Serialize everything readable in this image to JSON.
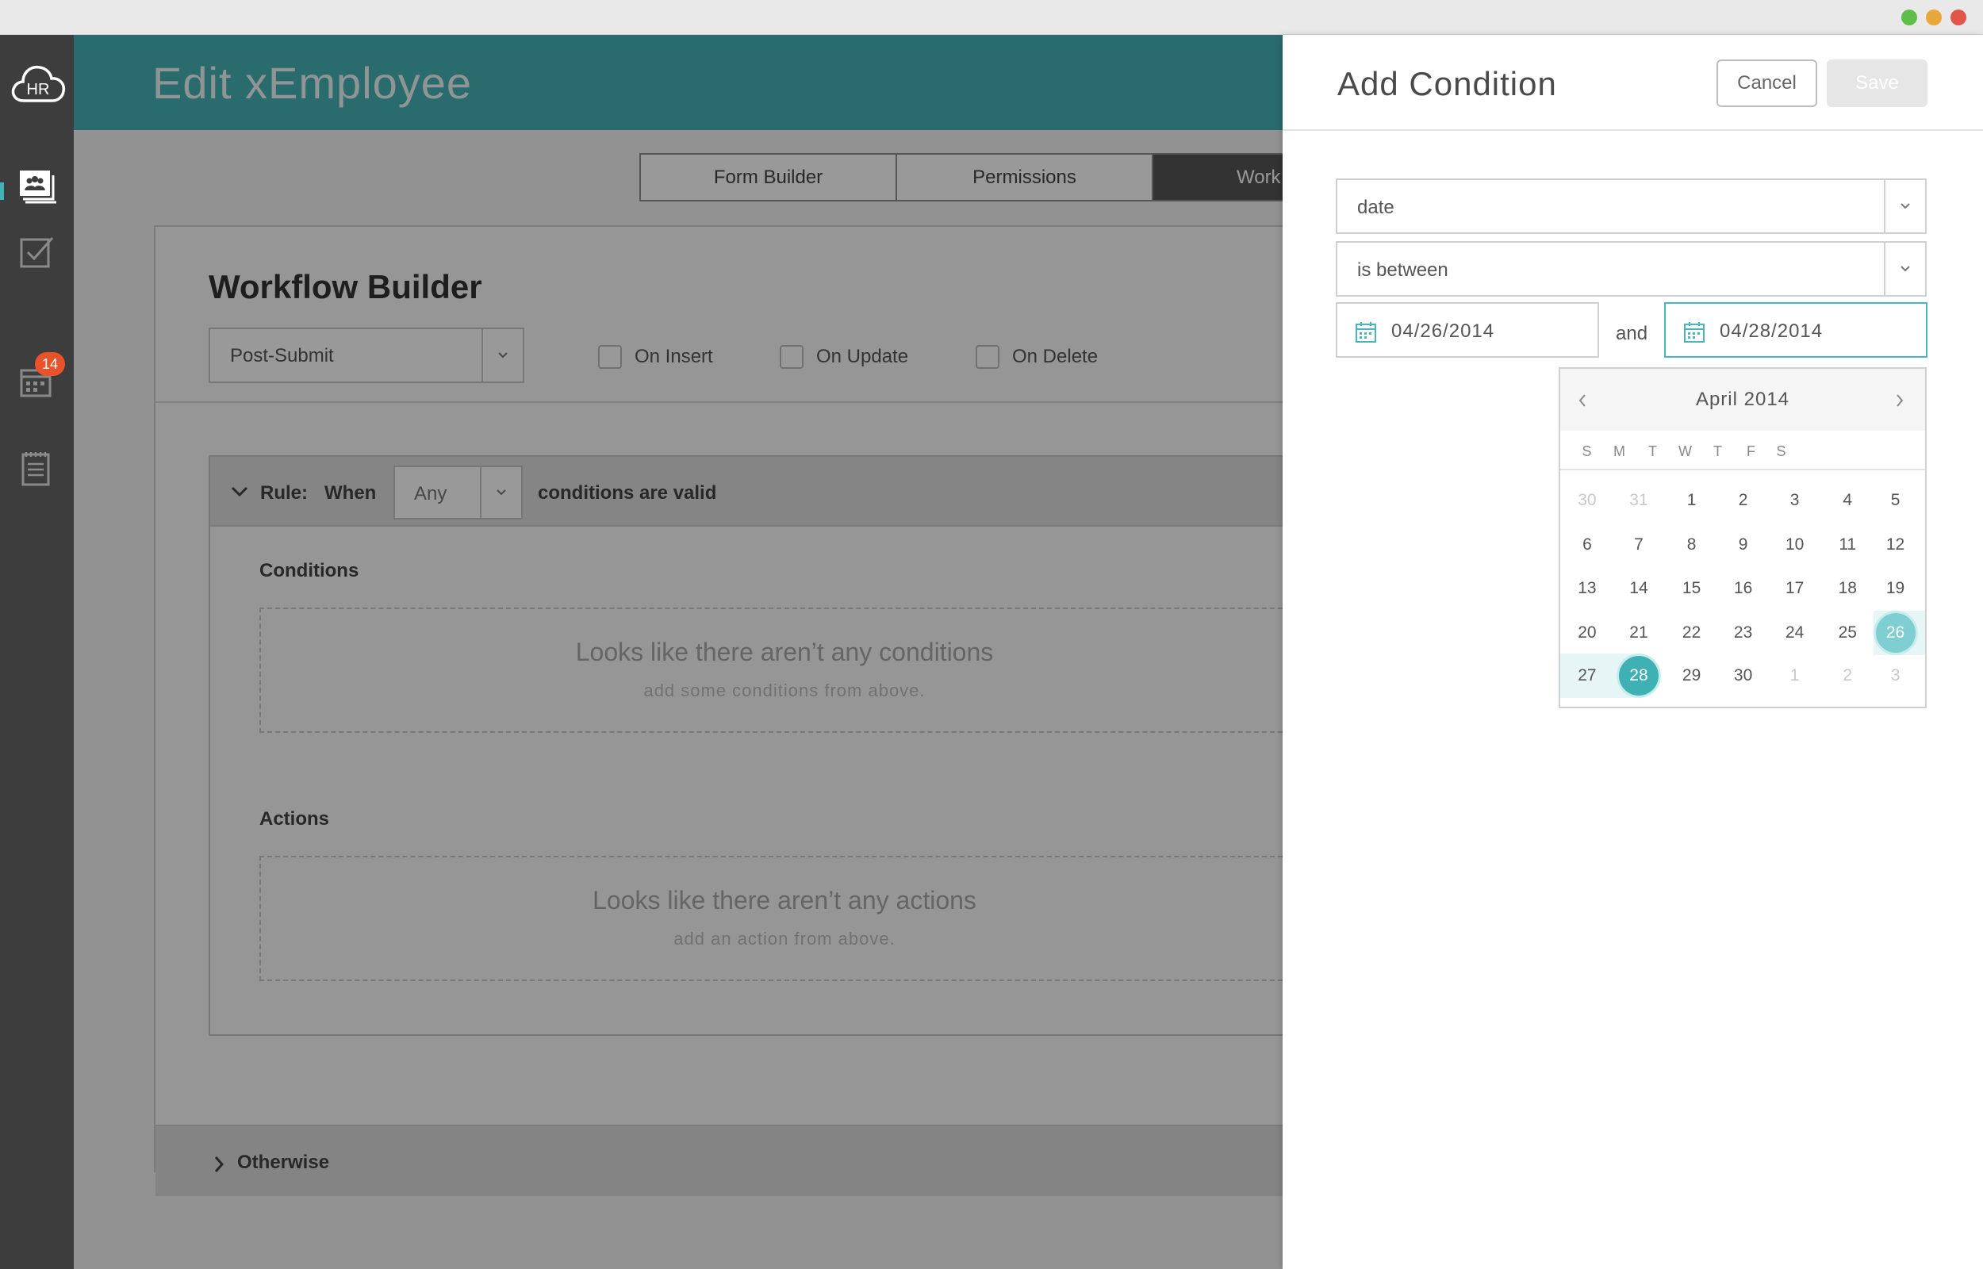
{
  "main": {
    "title": "Edit xEmployee",
    "tabs": [
      {
        "label": "Form Builder"
      },
      {
        "label": "Permissions"
      },
      {
        "label": "Work"
      }
    ]
  },
  "sidebar": {
    "logo_text": "HR",
    "badge_count": "14",
    "items": [
      {
        "icon": "people-icon",
        "active": true
      },
      {
        "icon": "check-icon",
        "active": false
      },
      {
        "icon": "calendar-icon",
        "active": false
      },
      {
        "icon": "notepad-icon",
        "active": false
      }
    ]
  },
  "workflow": {
    "title": "Workflow Builder",
    "trigger_select": "Post-Submit",
    "checkboxes": [
      {
        "label": "On Insert",
        "checked": false
      },
      {
        "label": "On Update",
        "checked": false
      },
      {
        "label": "On Delete",
        "checked": false
      }
    ],
    "rule": {
      "label": "Rule:",
      "when": "When",
      "match": "Any",
      "suffix": "conditions are valid",
      "conditions_label": "Conditions",
      "conditions_empty_title": "Looks like there aren’t any conditions",
      "conditions_empty_sub": "add some conditions from above.",
      "actions_label": "Actions",
      "actions_empty_title": "Looks like there aren’t any actions",
      "actions_empty_sub": "add an action from above."
    },
    "otherwise_label": "Otherwise"
  },
  "panel": {
    "title": "Add Condition",
    "cancel_label": "Cancel",
    "save_label": "Save",
    "field_select": "date",
    "operator_select": "is between",
    "start_date": "04/26/2014",
    "and_label": "and",
    "end_date": "04/28/2014"
  },
  "calendar": {
    "month_label": "April 2014",
    "weekdays": [
      "S",
      "M",
      "T",
      "W",
      "T",
      "F",
      "S"
    ],
    "weeks": [
      [
        {
          "d": "30",
          "o": true
        },
        {
          "d": "31",
          "o": true
        },
        {
          "d": "1"
        },
        {
          "d": "2"
        },
        {
          "d": "3"
        },
        {
          "d": "4"
        },
        {
          "d": "5"
        }
      ],
      [
        {
          "d": "6"
        },
        {
          "d": "7"
        },
        {
          "d": "8"
        },
        {
          "d": "9"
        },
        {
          "d": "10"
        },
        {
          "d": "11"
        },
        {
          "d": "12"
        }
      ],
      [
        {
          "d": "13"
        },
        {
          "d": "14"
        },
        {
          "d": "15"
        },
        {
          "d": "16"
        },
        {
          "d": "17"
        },
        {
          "d": "18"
        },
        {
          "d": "19"
        }
      ],
      [
        {
          "d": "20"
        },
        {
          "d": "21"
        },
        {
          "d": "22"
        },
        {
          "d": "23"
        },
        {
          "d": "24"
        },
        {
          "d": "25"
        },
        {
          "d": "26",
          "s": "start"
        }
      ],
      [
        {
          "d": "27",
          "s": "range"
        },
        {
          "d": "28",
          "s": "end"
        },
        {
          "d": "29"
        },
        {
          "d": "30"
        },
        {
          "d": "1",
          "o": true
        },
        {
          "d": "2",
          "o": true
        },
        {
          "d": "3",
          "o": true
        }
      ]
    ]
  },
  "colors": {
    "accent": "#46b3b8",
    "sidebar": "#3d3d3e",
    "badge": "#e8532c"
  }
}
